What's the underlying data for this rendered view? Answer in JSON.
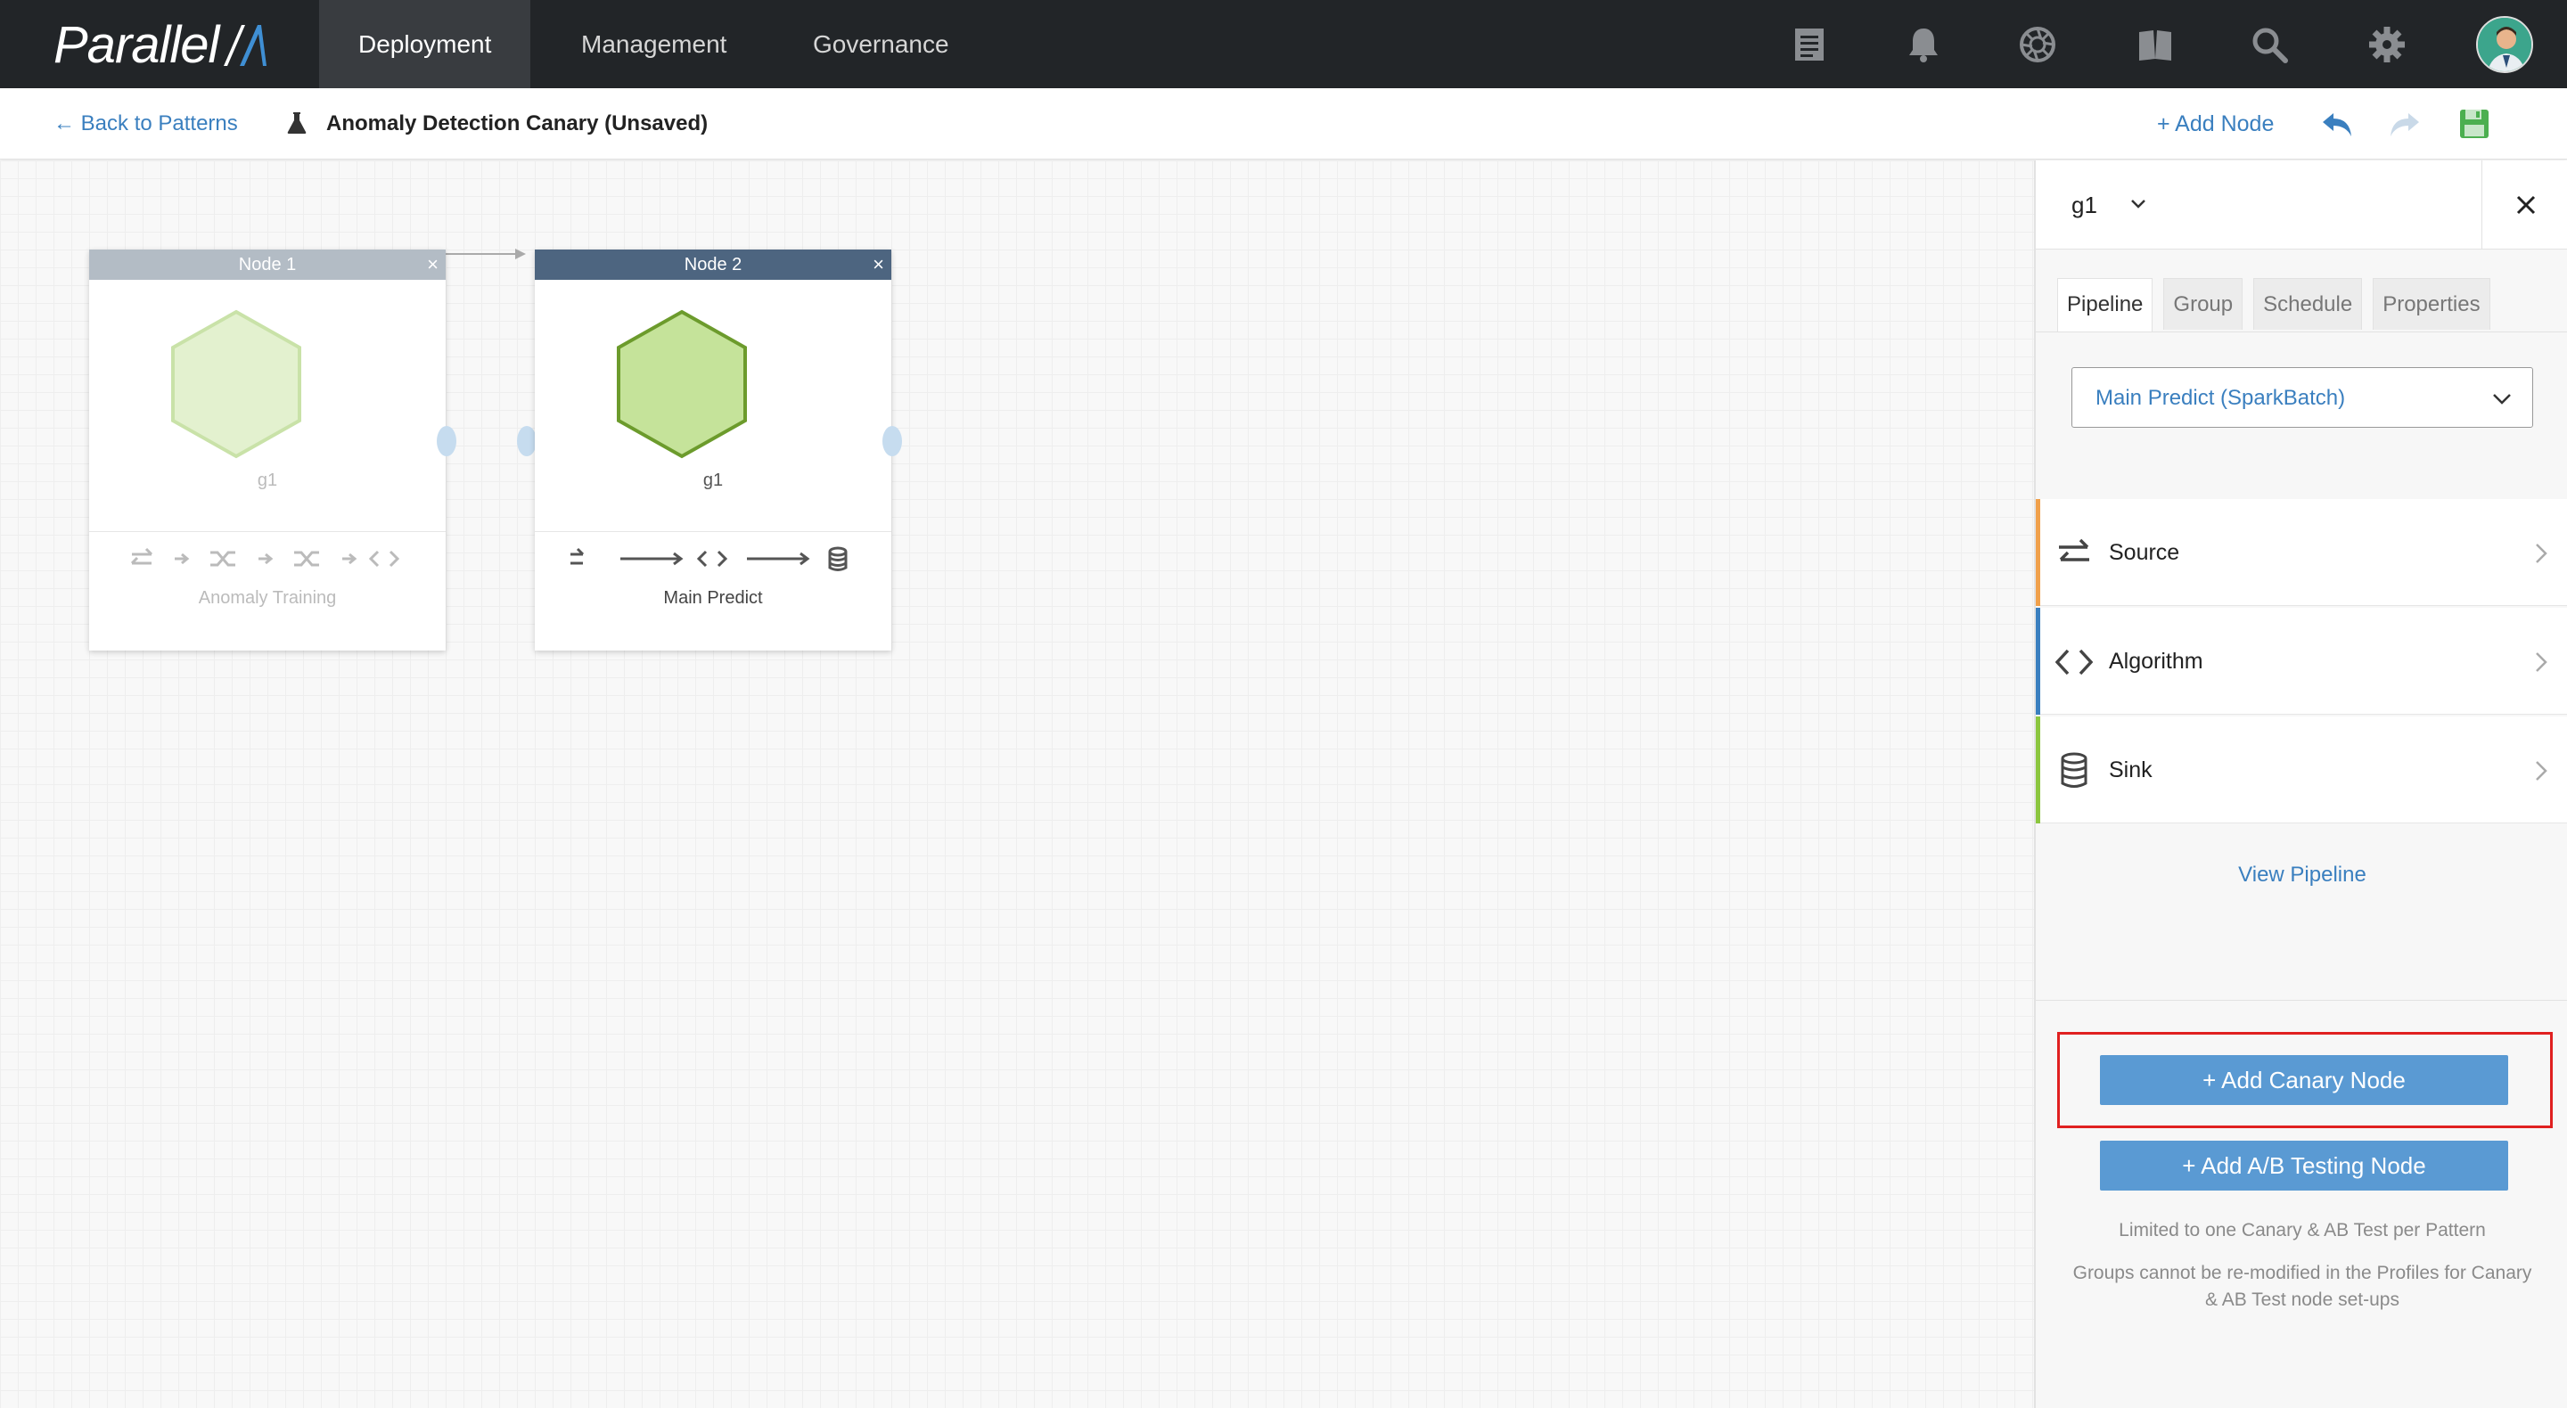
{
  "colors": {
    "nav_bg": "#222528",
    "accent_blue": "#3a7fbf",
    "button_blue": "#5a9ad3",
    "hex_green": "#c5e39a",
    "hex_stroke": "#6c9b2c",
    "source_bar": "#f0a04b",
    "algorithm_bar": "#3a7fbf",
    "sink_bar": "#8cc63f",
    "highlight_red": "#e02020"
  },
  "nav": {
    "logo_text": "Parallel",
    "tabs": [
      {
        "label": "Deployment",
        "active": true
      },
      {
        "label": "Management",
        "active": false
      },
      {
        "label": "Governance",
        "active": false
      }
    ],
    "icons": [
      "document-icon",
      "bell-icon",
      "aperture-icon",
      "book-icon",
      "search-icon",
      "gear-icon",
      "avatar"
    ]
  },
  "toolbar": {
    "back_label": "← Back to Patterns",
    "pattern_title": "Anomaly Detection Canary (Unsaved)",
    "add_node_label": "+ Add Node"
  },
  "canvas": {
    "nodes": [
      {
        "title": "Node 1",
        "close": "×",
        "group": "g1",
        "name": "Anomaly Training",
        "state": "inactive"
      },
      {
        "title": "Node 2",
        "close": "×",
        "group": "g1",
        "name": "Main Predict",
        "state": "selected"
      }
    ]
  },
  "panel": {
    "group_value": "g1",
    "close": "×",
    "tabs": [
      "Pipeline",
      "Group",
      "Schedule",
      "Properties"
    ],
    "active_tab": "Pipeline",
    "pipeline_value": "Main Predict (SparkBatch)",
    "steps": [
      {
        "label": "Source",
        "icon": "transfer-arrows-icon"
      },
      {
        "label": "Algorithm",
        "icon": "code-brackets-icon"
      },
      {
        "label": "Sink",
        "icon": "database-icon"
      }
    ],
    "view_pipeline": "View Pipeline",
    "add_canary": "+ Add Canary Node",
    "add_ab": "+ Add A/B Testing Node",
    "note1": "Limited to one Canary & AB Test per Pattern",
    "note2": "Groups cannot be re-modified in the Profiles for Canary & AB Test node set-ups"
  }
}
